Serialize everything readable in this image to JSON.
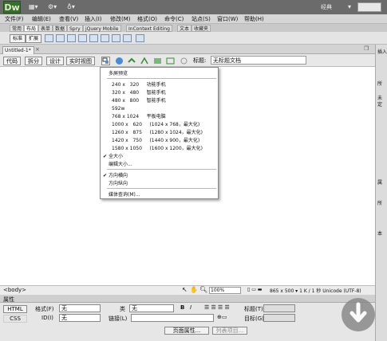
{
  "app": {
    "logo": "Dw",
    "workspace": "经典"
  },
  "menu": [
    "文件(F)",
    "编辑(E)",
    "查看(V)",
    "插入(I)",
    "修改(M)",
    "格式(O)",
    "命令(C)",
    "站点(S)",
    "窗口(W)",
    "帮助(H)"
  ],
  "insert_tabs": [
    "常用",
    "布局",
    "表单",
    "数据",
    "Spry",
    "jQuery Mobile",
    "InContext Editing",
    "文本",
    "收藏夹"
  ],
  "insert_sub": {
    "standard": "标准",
    "expanded": "扩展"
  },
  "document": {
    "tab": "Untitled-1*",
    "title_label": "标题:",
    "title_value": "无标题文档"
  },
  "view_buttons": [
    "代码",
    "拆分",
    "设计",
    "实时视图"
  ],
  "dropdown": {
    "items": [
      {
        "t": "多屏预览",
        "check": false
      },
      {
        "t": "240 x   320     功能手机",
        "check": false
      },
      {
        "t": "320 x   480     智能手机",
        "check": false
      },
      {
        "t": "480 x   800     智能手机",
        "check": false
      },
      {
        "t": "592w",
        "check": false
      },
      {
        "t": "768 x 1024     平板电脑",
        "check": false
      },
      {
        "t": "1000 x   620     (1024 x 768，最大化)",
        "check": false
      },
      {
        "t": "1260 x   875     (1280 x 1024，最大化)",
        "check": false
      },
      {
        "t": "1420 x   750     (1440 x 900，最大化)",
        "check": false
      },
      {
        "t": "1580 x 1050     (1600 x 1200，最大化)",
        "check": false
      },
      {
        "t": "全大小",
        "check": true
      },
      {
        "t": "编辑大小...",
        "check": false
      },
      {
        "t": "方向横向",
        "check": true
      },
      {
        "t": "方向纵向",
        "check": false
      },
      {
        "t": "媒体查询(M)...",
        "check": false
      }
    ]
  },
  "status": {
    "tag": "<body>",
    "zoom": "100%",
    "info": "865 x 500 ▾ 1 K / 1 秒  Unicode (UTF-8)"
  },
  "props": {
    "header": "属性",
    "html_label": "HTML",
    "css_label": "CSS",
    "format_label": "格式(F)",
    "format_value": "无",
    "id_label": "ID(I)",
    "id_value": "无",
    "class_label": "类",
    "class_value": "无",
    "link_label": "链接(L)",
    "title_label": "标题(T)",
    "target_label": "目标(G)",
    "page_props_btn": "页面属性...",
    "list_item_btn": "列表项目..."
  },
  "right_panel": [
    "插入",
    "所",
    "未",
    "定",
    "属",
    "所",
    "本"
  ]
}
